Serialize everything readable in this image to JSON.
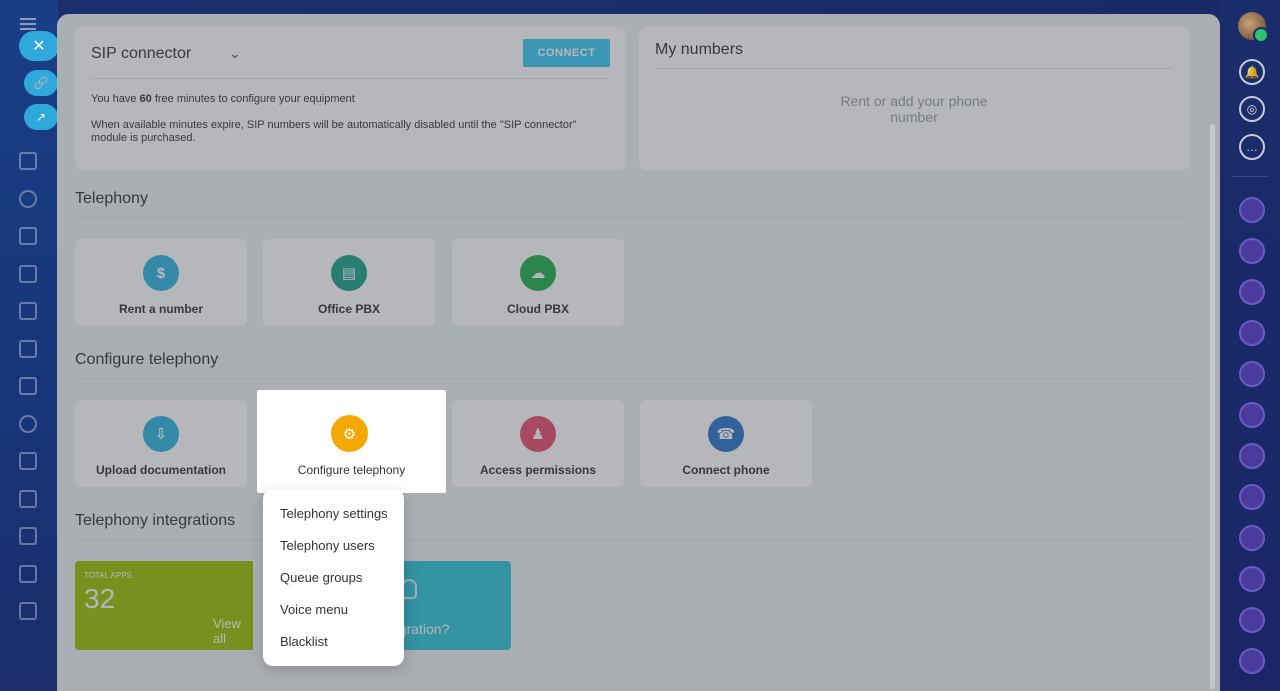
{
  "sip_connector": {
    "title": "SIP connector",
    "connect_label": "CONNECT",
    "line1_prefix": "You have ",
    "line1_minutes": "60",
    "line1_suffix": " free minutes to configure your equipment",
    "line2": "When available minutes expire, SIP numbers will be automatically disabled until the \"SIP connector\" module is purchased."
  },
  "my_numbers": {
    "title": "My numbers",
    "empty_text": "Rent or add your phone number"
  },
  "telephony": {
    "title": "Telephony",
    "tiles": [
      {
        "label": "Rent a number",
        "color": "#2fb5e0"
      },
      {
        "label": "Office PBX",
        "color": "#1ea28c"
      },
      {
        "label": "Cloud PBX",
        "color": "#22b14c"
      }
    ]
  },
  "configure": {
    "title": "Configure telephony",
    "tiles": [
      {
        "label": "Upload documentation",
        "color": "#2fb5e0"
      },
      {
        "label": "Configure telephony",
        "color": "#f5a900"
      },
      {
        "label": "Access permissions",
        "color": "#e8506e"
      },
      {
        "label": "Connect phone",
        "color": "#2a77c9"
      }
    ]
  },
  "dropdown": {
    "items": [
      "Telephony settings",
      "Telephony users",
      "Queue groups",
      "Voice menu",
      "Blacklist"
    ]
  },
  "integrations": {
    "title": "Telephony integrations",
    "total_label": "TOTAL APPS",
    "total_value": "32",
    "view_all": "View all",
    "partial_text": "egration?"
  },
  "colors": {
    "accent": "#3bc8f5",
    "apps_green": "#9dc000",
    "integ_teal": "#2fc6d6"
  }
}
